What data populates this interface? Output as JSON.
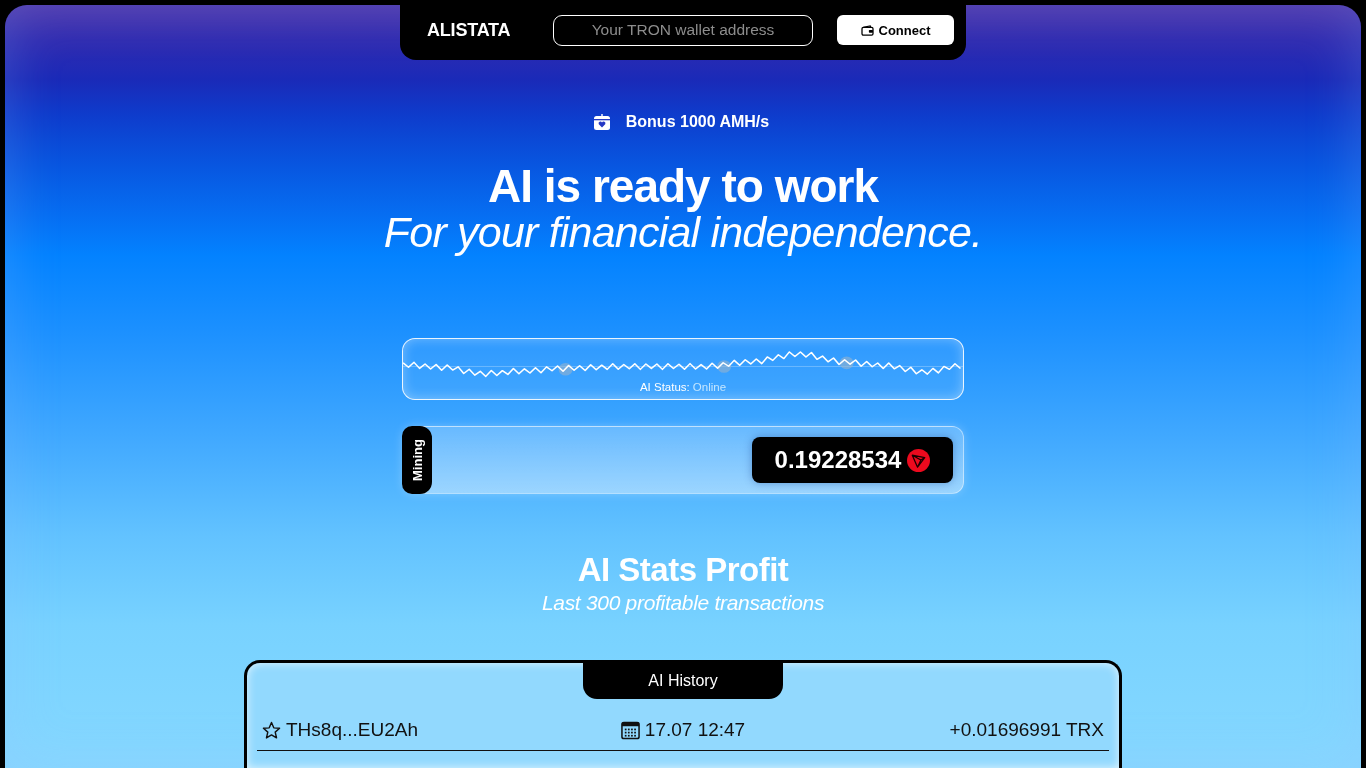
{
  "header": {
    "logo": "ALISTATA",
    "wallet_field": {
      "placeholder": "Your TRON wallet address"
    },
    "connect_button": "Connect"
  },
  "bonus": "Bonus 1000 AMH/s",
  "hero": {
    "title": "AI is ready to work",
    "subtitle": "For your financial independence."
  },
  "status": {
    "label": "AI Status:",
    "value": "Online"
  },
  "mining": {
    "label": "Mining",
    "amount": "0.19228534"
  },
  "stats": {
    "title": "AI Stats Profit",
    "subtitle": "Last 300 profitable transactions"
  },
  "history": {
    "title": "AI History",
    "rows": [
      {
        "address": "THs8q...EU2Ah",
        "time": "17.07 12:47",
        "amount": "+0.01696991 TRX"
      }
    ]
  }
}
